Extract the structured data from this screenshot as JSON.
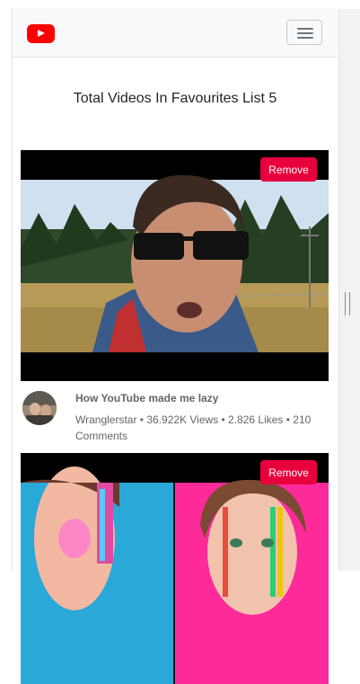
{
  "navbar": {
    "logo": "youtube-logo",
    "menu_icon": "hamburger-icon"
  },
  "heading": "Total Videos In Favourites List 5",
  "videos": [
    {
      "remove_label": "Remove",
      "title": "How YouTube made me lazy",
      "info": "Wranglerstar • 36.922K Views • 2.826 Likes • 210 Comments"
    },
    {
      "remove_label": "Remove"
    }
  ],
  "colors": {
    "remove_button": "#e8003d",
    "logo_red": "#ff0000",
    "navbar_bg": "#f8f9fa"
  }
}
